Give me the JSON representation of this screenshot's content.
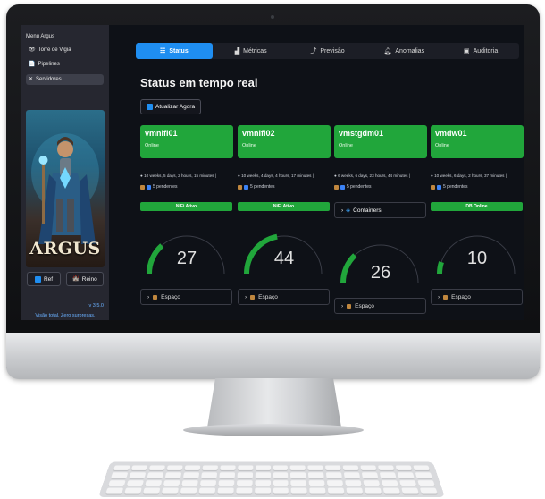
{
  "sidebar": {
    "title": "Menu Argus",
    "items": [
      {
        "label": "Torre de Vigia",
        "icon": "eye-icon"
      },
      {
        "label": "Pipelines",
        "icon": "document-icon"
      },
      {
        "label": "Servidores",
        "icon": "wrench-icon"
      }
    ],
    "hero_text": "ARGUS",
    "btn_ref": "Ref",
    "btn_reino": "Reino",
    "version": "v 3.5.0",
    "tagline": "Visão total. Zero surpresas."
  },
  "tabs": [
    {
      "label": "Status",
      "icon": "grid-icon"
    },
    {
      "label": "Métricas",
      "icon": "bar-chart-icon"
    },
    {
      "label": "Previsão",
      "icon": "trend-icon"
    },
    {
      "label": "Anomalias",
      "icon": "bell-icon"
    },
    {
      "label": "Auditoria",
      "icon": "clipboard-icon"
    }
  ],
  "main": {
    "title": "Status em tempo real",
    "refresh_label": "Atualizar Agora"
  },
  "servers": [
    {
      "name": "vmnifi01",
      "status": "Online",
      "uptime": "10 weeks, 5 days, 2 hours, 15 minutes |",
      "pending": "5 pendentes",
      "badge": "NiFi Ativo",
      "gauge": 27,
      "max": 100,
      "esp": "Espaço"
    },
    {
      "name": "vmnifi02",
      "status": "Online",
      "uptime": "10 weeks, 4 days, 4 hours, 17 minutes |",
      "pending": "5 pendentes",
      "badge": "NiFi Ativo",
      "gauge": 44,
      "max": 100,
      "esp": "Espaço"
    },
    {
      "name": "vmstgdm01",
      "status": "Online",
      "uptime": "6 weeks, 6 days, 23 hours, 44 minutes |",
      "pending": "5 pendentes",
      "container": "Containers",
      "gauge": 26,
      "max": 100,
      "esp": "Espaço"
    },
    {
      "name": "vmdw01",
      "status": "Online",
      "uptime": "10 weeks, 6 days, 2 hours, 37 minutes |",
      "pending": "5 pendentes",
      "badge": "DB Online",
      "gauge": 10,
      "max": 100,
      "esp": "Espaço"
    }
  ],
  "colors": {
    "accent": "#1f8ef1",
    "online": "#21a63b"
  }
}
